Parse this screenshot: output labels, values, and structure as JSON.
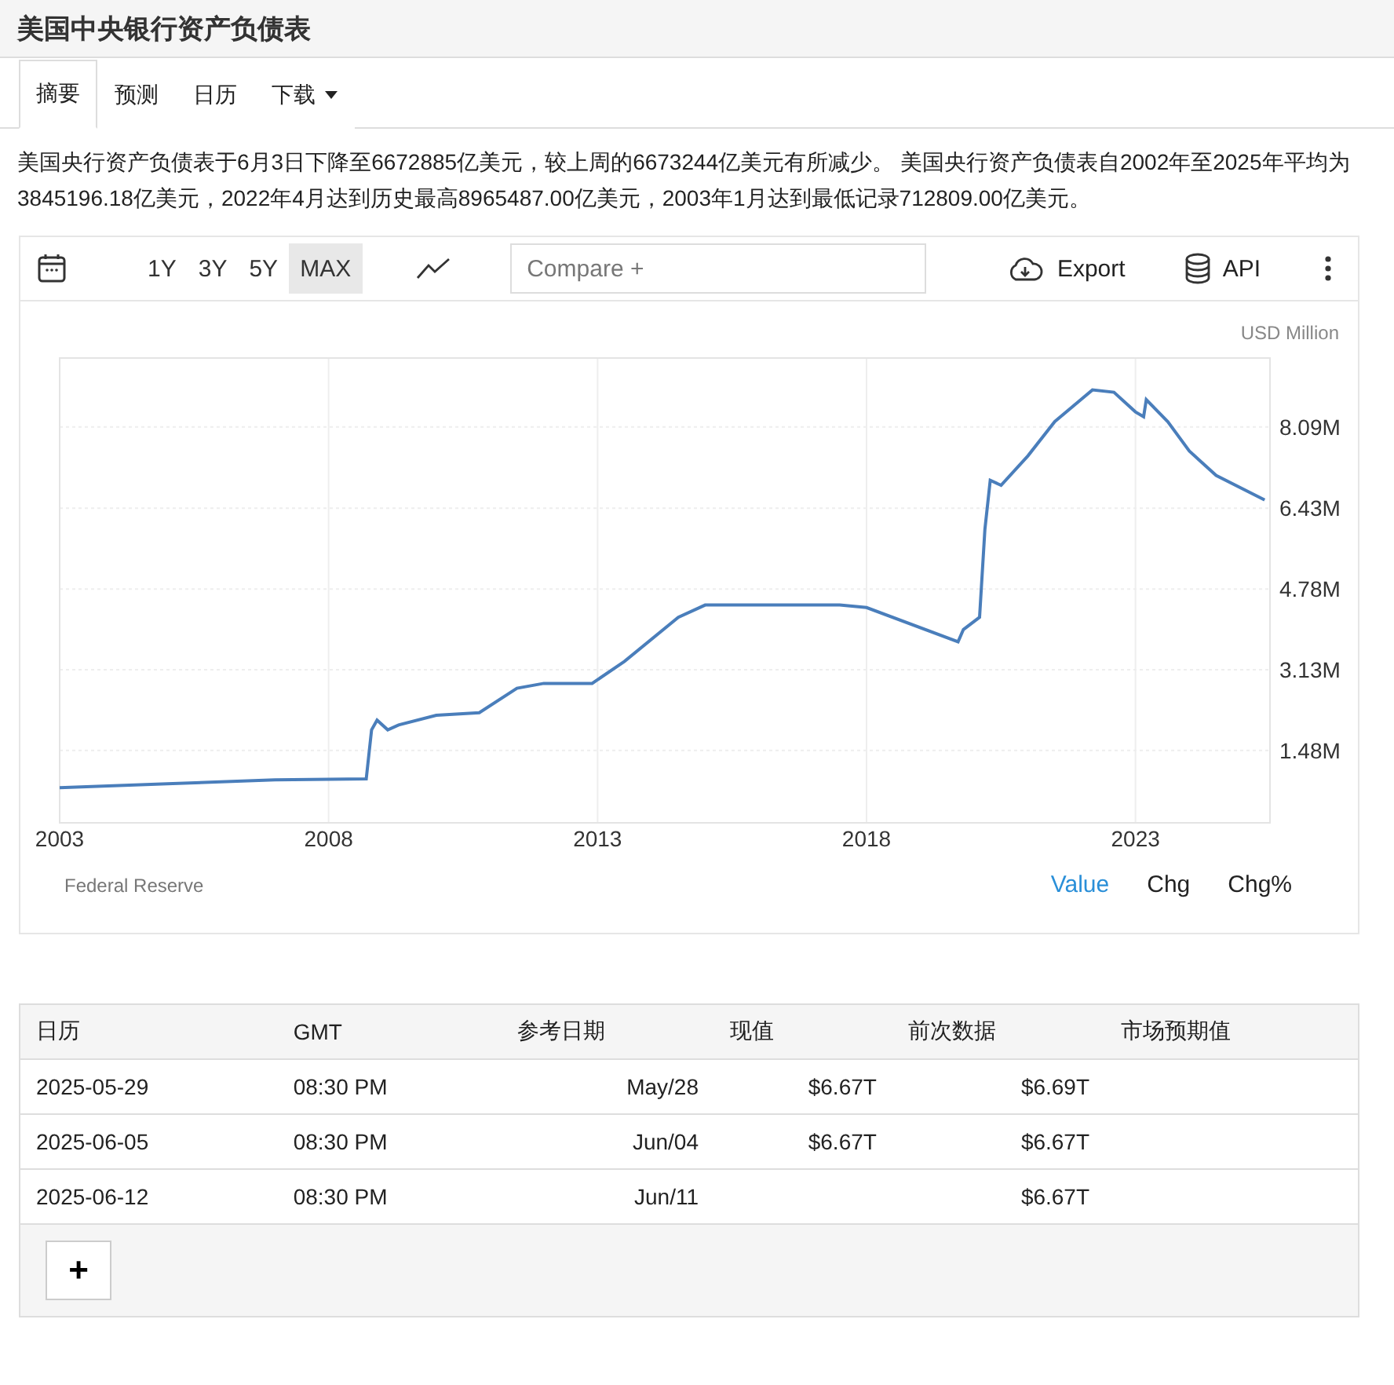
{
  "title": "美国中央银行资产负债表",
  "tabs": [
    {
      "label": "摘要",
      "selected": true
    },
    {
      "label": "预测",
      "selected": false
    },
    {
      "label": "日历",
      "selected": false
    },
    {
      "label": "下载",
      "selected": false,
      "dropdown": true
    }
  ],
  "summary": "美国央行资产负债表于6月3日下降至6672885亿美元，较上周的6673244亿美元有所减少。 美国央行资产负债表自2002年至2025年平均为3845196.18亿美元，2022年4月达到历史最高8965487.00亿美元，2003年1月达到最低记录712809.00亿美元。",
  "toolbar": {
    "ranges": [
      {
        "label": "1Y",
        "selected": false
      },
      {
        "label": "3Y",
        "selected": false
      },
      {
        "label": "5Y",
        "selected": false
      },
      {
        "label": "MAX",
        "selected": true
      }
    ],
    "compare_placeholder": "Compare +",
    "export": "Export",
    "api": "API"
  },
  "chart": {
    "unit": "USD Million",
    "source": "Federal Reserve",
    "modes": [
      {
        "label": "Value",
        "selected": true
      },
      {
        "label": "Chg",
        "selected": false
      },
      {
        "label": "Chg%",
        "selected": false
      }
    ],
    "chart_data": {
      "type": "line",
      "x": [
        2003,
        2005,
        2007,
        2008.7,
        2008.8,
        2008.9,
        2009.1,
        2009.3,
        2010,
        2010.8,
        2011.5,
        2012,
        2012.9,
        2013.5,
        2014.5,
        2015,
        2017.5,
        2018,
        2019.7,
        2019.8,
        2020.1,
        2020.2,
        2020.3,
        2020.5,
        2021,
        2021.5,
        2022.2,
        2022.6,
        2023.0,
        2023.15,
        2023.2,
        2023.6,
        2024,
        2024.5,
        2025.4
      ],
      "values": [
        0.72,
        0.8,
        0.88,
        0.9,
        1.9,
        2.1,
        1.9,
        2.0,
        2.2,
        2.25,
        2.75,
        2.85,
        2.85,
        3.3,
        4.2,
        4.45,
        4.45,
        4.4,
        3.7,
        3.95,
        4.2,
        6.0,
        7.0,
        6.9,
        7.5,
        8.2,
        8.85,
        8.8,
        8.4,
        8.3,
        8.65,
        8.2,
        7.6,
        7.1,
        6.6
      ],
      "grid": true,
      "xlim": [
        2003,
        2025.5
      ],
      "ylim": [
        0,
        9.5
      ],
      "xticks": [
        2003,
        2008,
        2013,
        2018,
        2023
      ],
      "yticks": [
        {
          "value": 1.48,
          "label": "1.48M"
        },
        {
          "value": 3.13,
          "label": "3.13M"
        },
        {
          "value": 4.78,
          "label": "4.78M"
        },
        {
          "value": 6.43,
          "label": "6.43M"
        },
        {
          "value": 8.09,
          "label": "8.09M"
        }
      ]
    }
  },
  "table": {
    "columns": [
      "日历",
      "GMT",
      "参考日期",
      "现值",
      "前次数据",
      "市场预期值"
    ],
    "rows": [
      [
        "2025-05-29",
        "08:30 PM",
        "May/28",
        "$6.67T",
        "$6.69T",
        ""
      ],
      [
        "2025-06-05",
        "08:30 PM",
        "Jun/04",
        "$6.67T",
        "$6.67T",
        ""
      ],
      [
        "2025-06-12",
        "08:30 PM",
        "Jun/11",
        "",
        "$6.67T",
        ""
      ]
    ],
    "add_button": "+"
  }
}
